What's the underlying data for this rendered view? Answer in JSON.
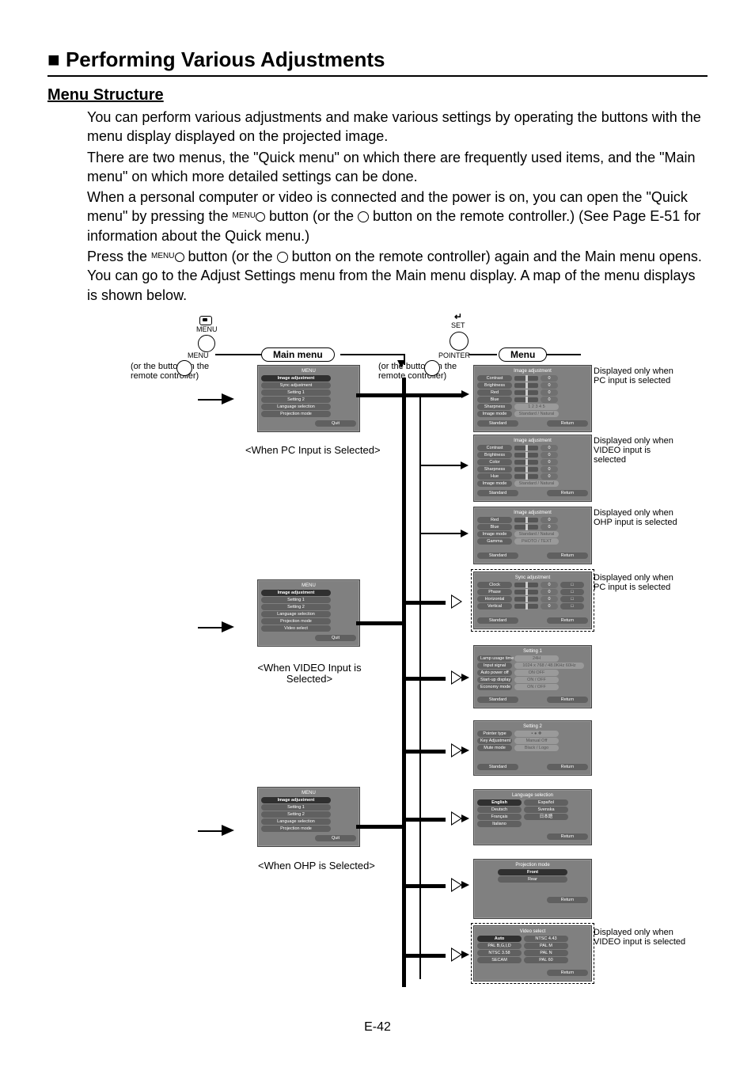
{
  "title_prefix": "■ ",
  "title": "Performing Various Adjustments",
  "subtitle": "Menu Structure",
  "paragraphs": {
    "p1": "You can perform various adjustments and make various settings by operating the buttons with the menu display displayed on the projected image.",
    "p2": "There are two menus, the \"Quick menu\" on which there are frequently used items, and the \"Main menu\" on which more detailed settings can be done.",
    "p3a": "When a personal computer or video is connected and the power is on, you can open the \"Quick menu\" by pressing the ",
    "p3b": " button (or the ",
    "p3c": " button on the remote controller.) (See Page E-51 for information about the Quick menu.)",
    "p4a": "Press the ",
    "p4b": " button (or the ",
    "p4c": " button on the remote controller) again and the Main menu opens. You can go to the Adjust Settings menu from the Main menu display. A map of the menu displays is shown below."
  },
  "top_labels": {
    "menu_icon": "MENU",
    "set": "SET",
    "pointer": "POINTER"
  },
  "pills": {
    "main_menu": "Main menu",
    "menu": "Menu"
  },
  "remote_note": "(or the        button on the remote controller)",
  "captions": {
    "pc": "<When PC Input is Selected>",
    "video": "<When VIDEO Input is Selected>",
    "ohp": "<When OHP is Selected>"
  },
  "side_notes": {
    "pc": "Displayed only when PC input is selected",
    "video": "Displayed only when VIDEO input is selected",
    "ohp": "Displayed only when OHP input is selected",
    "pc2": "Displayed only when PC input is selected",
    "video2": "Displayed only when VIDEO input is selected"
  },
  "menus": {
    "main_pc": {
      "title": "MENU",
      "items": [
        "Image adjustment",
        "Sync adjustment",
        "Setting 1",
        "Setting 2",
        "Language selection",
        "Projection mode"
      ],
      "quit": "Quit"
    },
    "main_video": {
      "title": "MENU",
      "items": [
        "Image adjustment",
        "Setting 1",
        "Setting 2",
        "Language selection",
        "Projection mode",
        "Video select"
      ],
      "quit": "Quit"
    },
    "main_ohp": {
      "title": "MENU",
      "items": [
        "Image adjustment",
        "Setting 1",
        "Setting 2",
        "Language selection",
        "Projection mode"
      ],
      "quit": "Quit"
    },
    "img_pc": {
      "title": "Image adjustment",
      "rows": [
        {
          "name": "Contrast",
          "range": "-30  +30",
          "val": "0"
        },
        {
          "name": "Brightness",
          "range": "-30  +30",
          "val": "0"
        },
        {
          "name": "Red",
          "range": "-30  +30",
          "val": "0"
        },
        {
          "name": "Blue",
          "range": "-30  +30",
          "val": "0"
        }
      ],
      "sharp": {
        "name": "Sharpness",
        "opts": "1  2  3  4  5"
      },
      "mode": {
        "name": "Image mode",
        "opts": "Standard / Natural"
      },
      "std": "Standard",
      "ret": "Return"
    },
    "img_video": {
      "title": "Image adjustment",
      "rows": [
        {
          "name": "Contrast",
          "range": "-30  +30",
          "val": "0"
        },
        {
          "name": "Brightness",
          "range": "-30  +30",
          "val": "0"
        },
        {
          "name": "Color",
          "range": "-30  +30",
          "val": "0"
        },
        {
          "name": "Sharpness",
          "range": "-30  +30",
          "val": "0"
        },
        {
          "name": "Hue",
          "range": "-30  +30",
          "val": "0"
        }
      ],
      "mode": {
        "name": "Image mode",
        "opts": "Standard / Natural"
      },
      "std": "Standard",
      "ret": "Return"
    },
    "img_ohp": {
      "title": "Image adjustment",
      "rows": [
        {
          "name": "Red",
          "range": "-30  +30",
          "val": "0"
        },
        {
          "name": "Blue",
          "range": "-30  +30",
          "val": "0"
        }
      ],
      "mode": {
        "name": "Image mode",
        "opts": "Standard / Natural"
      },
      "gamma": {
        "name": "Gamma",
        "opts": "PHOTO  /  TEXT"
      },
      "std": "Standard",
      "ret": "Return"
    },
    "sync": {
      "title": "Sync adjustment",
      "rows": [
        {
          "name": "Clock",
          "val": "0"
        },
        {
          "name": "Phase",
          "val": "0"
        },
        {
          "name": "Horizontal",
          "val": "0"
        },
        {
          "name": "Vertical",
          "val": "0"
        }
      ],
      "std": "Standard",
      "ret": "Return"
    },
    "setting1": {
      "title": "Setting 1",
      "rows": [
        {
          "name": "Lamp usage time",
          "opts": "24H"
        },
        {
          "name": "Input signal",
          "opts": "1024 x 768 / 48.0KHz 60Hz"
        },
        {
          "name": "Auto power off",
          "opts": "ON  OFF"
        },
        {
          "name": "Start-up display",
          "opts": "ON  /  OFF"
        },
        {
          "name": "Economy mode",
          "opts": "ON  /  OFF"
        }
      ],
      "std": "Standard",
      "ret": "Return"
    },
    "setting2": {
      "title": "Setting 2",
      "rows": [
        {
          "name": "Pointer type",
          "opts": "▪   ●   ✚"
        },
        {
          "name": "Key Adjustment",
          "opts": "Manual  Off"
        },
        {
          "name": "Mute mode",
          "opts": "Black  /  Logo"
        }
      ],
      "std": "Standard",
      "ret": "Return"
    },
    "language": {
      "title": "Language selection",
      "rows": [
        [
          "English",
          "Español"
        ],
        [
          "Deutsch",
          "Svenska"
        ],
        [
          "Français",
          "日本語"
        ],
        [
          "Italiano",
          ""
        ]
      ],
      "ret": "Return"
    },
    "projection": {
      "title": "Projection mode",
      "rows": [
        "Front",
        "Rear"
      ],
      "ret": "Return"
    },
    "videosel": {
      "title": "Video select",
      "rows": [
        [
          "Auto",
          "NTSC 4.43"
        ],
        [
          "PAL B,G,I,D",
          "PAL M"
        ],
        [
          "NTSC 3.58",
          "PAL N"
        ],
        [
          "SECAM",
          "PAL 60"
        ]
      ],
      "ret": "Return"
    }
  },
  "pagenum": "E-42"
}
